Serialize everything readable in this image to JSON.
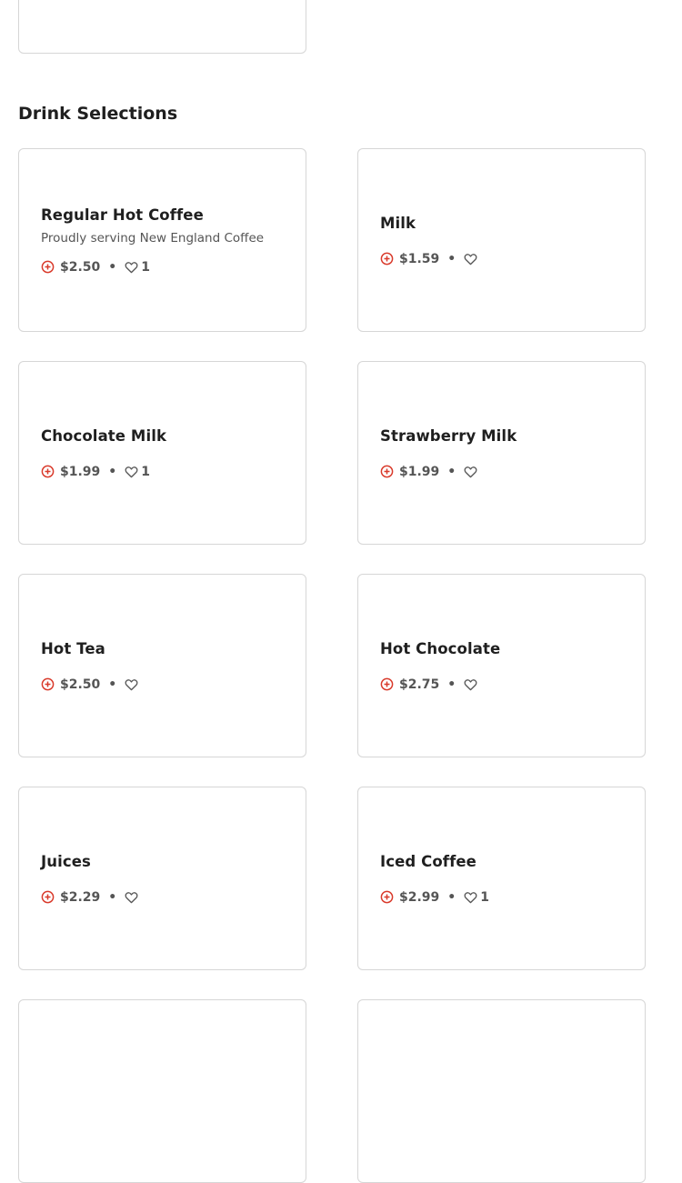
{
  "section": {
    "title": "Drink Selections"
  },
  "items": [
    {
      "name": "Regular Hot Coffee",
      "description": "Proudly serving New England Coffee",
      "price": "$2.50",
      "likes": "1"
    },
    {
      "name": "Milk",
      "description": "",
      "price": "$1.59",
      "likes": ""
    },
    {
      "name": "Chocolate Milk",
      "description": "",
      "price": "$1.99",
      "likes": "1"
    },
    {
      "name": "Strawberry Milk",
      "description": "",
      "price": "$1.99",
      "likes": ""
    },
    {
      "name": "Hot Tea",
      "description": "",
      "price": "$2.50",
      "likes": ""
    },
    {
      "name": "Hot Chocolate",
      "description": "",
      "price": "$2.75",
      "likes": ""
    },
    {
      "name": "Juices",
      "description": "",
      "price": "$2.29",
      "likes": ""
    },
    {
      "name": "Iced Coffee",
      "description": "",
      "price": "$2.99",
      "likes": "1"
    }
  ],
  "separator": "•",
  "icons": {
    "add": "add-circle-icon",
    "like": "heart-outline-icon"
  },
  "colors": {
    "accent": "#d93a2b",
    "text": "#1f1f1f",
    "muted": "#555555",
    "border": "#d6d6d6"
  }
}
